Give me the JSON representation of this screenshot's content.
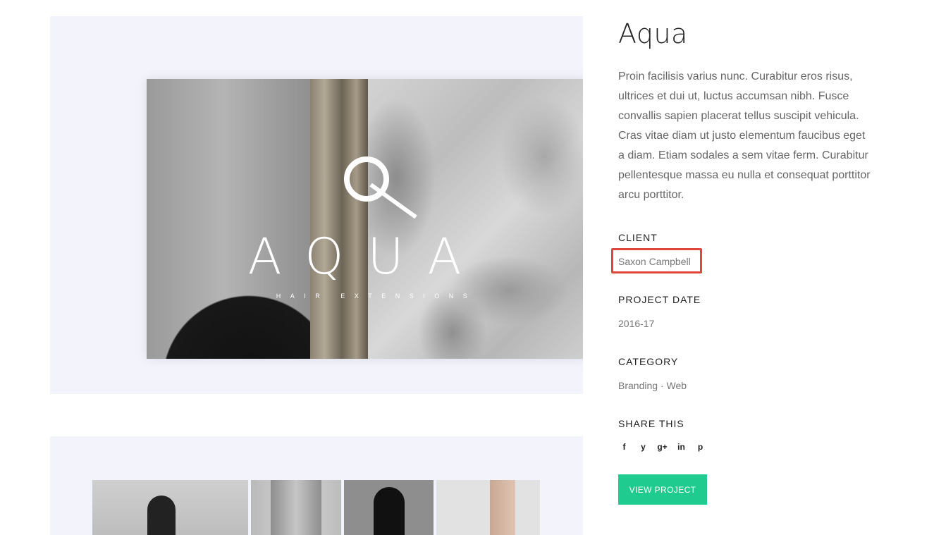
{
  "project": {
    "title": "Aqua",
    "description": "Proin facilisis varius nunc. Curabitur eros risus, ultrices et dui ut, luctus accumsan nibh. Fusce convallis sapien placerat tellus suscipit vehicula. Cras vitae diam ut justo elementum faucibus eget a diam. Etiam sodales a sem vitae ferm. Curabitur pellentesque massa eu nulla et consequat porttitor arcu porttitor."
  },
  "hero": {
    "logo_word": "AQUA",
    "logo_letter": "Q",
    "logo_subtitle": "HAIR EXTENSIONS"
  },
  "details": {
    "client_label": "CLIENT",
    "client_value": "Saxon Campbell",
    "date_label": "PROJECT DATE",
    "date_value": "2016-17",
    "category_label": "CATEGORY",
    "category_value": "Branding · Web"
  },
  "share": {
    "label": "SHARE THIS",
    "icons": [
      "facebook-icon",
      "twitter-icon",
      "google-plus-icon",
      "linkedin-icon",
      "pinterest-icon"
    ],
    "glyphs": [
      "f",
      "y",
      "g+",
      "in",
      "p"
    ]
  },
  "actions": {
    "view_project": "VIEW PROJECT"
  },
  "colors": {
    "accent": "#1fcb8f",
    "highlight": "#e0463b",
    "panel_bg": "#f3f3fb"
  }
}
